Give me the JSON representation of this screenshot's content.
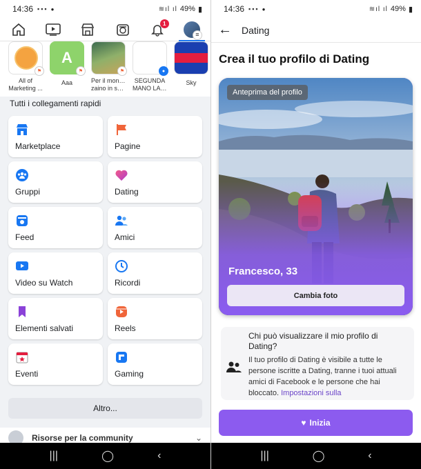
{
  "left": {
    "status": {
      "time": "14:36",
      "battery": "49%"
    },
    "nav": {
      "notification_count": "1"
    },
    "shortcuts": [
      {
        "line1": "All of",
        "line2": "Marketing ..."
      },
      {
        "line1": "Aaa",
        "line2": "",
        "letter": "A"
      },
      {
        "line1": "Per il mondo",
        "line2": "zaino in sp..."
      },
      {
        "line1": "SEGUNDA",
        "line2": "MANO LAS..."
      },
      {
        "line1": "Sky",
        "line2": ""
      }
    ],
    "section_title": "Tutti i collegamenti rapidi",
    "tiles": [
      {
        "label": "Marketplace",
        "icon": "marketplace-icon",
        "color": "#1877f2"
      },
      {
        "label": "Pagine",
        "icon": "flag-icon",
        "color": "#f0653a"
      },
      {
        "label": "Gruppi",
        "icon": "groups-icon",
        "color": "#1877f2"
      },
      {
        "label": "Dating",
        "icon": "heart-icon",
        "color": "#e8457b"
      },
      {
        "label": "Feed",
        "icon": "feed-icon",
        "color": "#1877f2"
      },
      {
        "label": "Amici",
        "icon": "friends-icon",
        "color": "#1877f2"
      },
      {
        "label": "Video su Watch",
        "icon": "video-icon",
        "color": "#1877f2"
      },
      {
        "label": "Ricordi",
        "icon": "clock-icon",
        "color": "#1877f2"
      },
      {
        "label": "Elementi salvati",
        "icon": "bookmark-icon",
        "color": "#8b42d8"
      },
      {
        "label": "Reels",
        "icon": "reels-icon",
        "color": "#f0653a"
      },
      {
        "label": "Eventi",
        "icon": "calendar-icon",
        "color": "#e41e3f"
      },
      {
        "label": "Gaming",
        "icon": "gaming-icon",
        "color": "#1877f2"
      }
    ],
    "altro_label": "Altro...",
    "community_label": "Risorse per la community"
  },
  "right": {
    "status": {
      "time": "14:36",
      "battery": "49%"
    },
    "header_title": "Dating",
    "heading": "Crea il tuo profilo di Dating",
    "preview_chip": "Anteprima del profilo",
    "profile_name": "Francesco, 33",
    "change_photo": "Cambia foto",
    "faq_question": "Chi può visualizzare il mio profilo di Dating?",
    "faq_answer": "Il tuo profilo di Dating è visibile a tutte le persone iscritte a Dating, tranne i tuoi attuali amici di Facebook e le persone che hai bloccato.",
    "faq_link": "Impostazioni sulla",
    "start_button": "Inizia"
  },
  "colors": {
    "brand": "#1877f2",
    "dating_purple": "#8c5bef"
  }
}
